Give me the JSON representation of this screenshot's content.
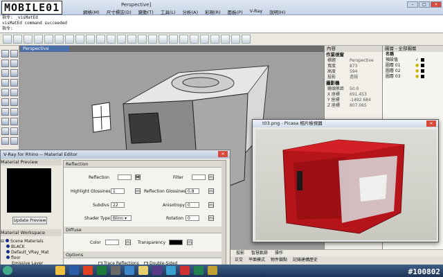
{
  "app": {
    "logo_text": "MOBILE01",
    "window_title": "Perspective]",
    "menu": [
      "網格(M)",
      "尺寸標註(D)",
      "變動(T)",
      "工具(L)",
      "分析(A)",
      "彩現(R)",
      "面板(P)",
      "V-Ray",
      "說明(H)"
    ]
  },
  "command": {
    "line1": "指令: _visMatEd",
    "line2": "visMatEd command succeeded",
    "prompt": "指令:"
  },
  "viewport": {
    "tab_label": "Perspective"
  },
  "properties": {
    "tab": "內容",
    "section_title": "作業視窗",
    "rows": [
      {
        "k": "標題",
        "v": "Perspective"
      },
      {
        "k": "寬度",
        "v": "873"
      },
      {
        "k": "高度",
        "v": "594"
      },
      {
        "k": "投影",
        "v": "透視"
      }
    ],
    "camera_title": "攝影機",
    "camera_rows": [
      {
        "k": "鏡頭焦距",
        "v": "50.0"
      },
      {
        "k": "X 座標",
        "v": "691.453"
      },
      {
        "k": "Y 座標",
        "v": "-1492.684"
      },
      {
        "k": "Z 座標",
        "v": "807.065"
      }
    ]
  },
  "layers": {
    "tab": "圖層 - 全部圖層",
    "header": "名稱",
    "items": [
      "預設值",
      "圖層 01",
      "圖層 02",
      "圖層 03"
    ]
  },
  "material_editor": {
    "title": "V-Ray for Rhino -- Material Editor",
    "preview_caption": "Material Preview",
    "update_button": "Update Preview",
    "workspace_caption": "Material Workspace",
    "tree": [
      "Scene Materials",
      "BLACK",
      "Default_VRay_Mat",
      "floor",
      "Emissive Layer"
    ],
    "reflection": {
      "header": "Reflection",
      "reflection_label": "Reflection",
      "filter_label": "Filter",
      "hilight_label": "Highlight Glossiness",
      "hilight_value": "1",
      "refl_gloss_label": "Reflection Glossiness",
      "refl_gloss_value": "0.8",
      "subdivs_label": "Subdivs",
      "subdivs_value": "22",
      "aniso_label": "Anisotropy",
      "aniso_value": "0",
      "shader_label": "Shader Type",
      "shader_value": "Blinn",
      "rotation_label": "Rotation",
      "rotation_value": "0"
    },
    "diffuse": {
      "header": "Diffuse",
      "color_label": "Color",
      "transparency_label": "Transparency"
    },
    "options": {
      "header": "Options",
      "trace_reflections": "Trace Reflections",
      "double_sided": "Double-Sided"
    },
    "m_button": "m",
    "M_button": "M"
  },
  "picasa": {
    "title": "t03.png - Picasa 相片檢視器"
  },
  "status": {
    "row1": [
      "投影",
      "智慧軌跡",
      "操作"
    ],
    "row2": [
      "正交",
      "平面模式",
      "物件鎖點",
      "記錄建構歷史"
    ]
  },
  "watermark": "#100802",
  "colors": {
    "accent": "#4a6ea8",
    "product_red": "#c0171a"
  }
}
